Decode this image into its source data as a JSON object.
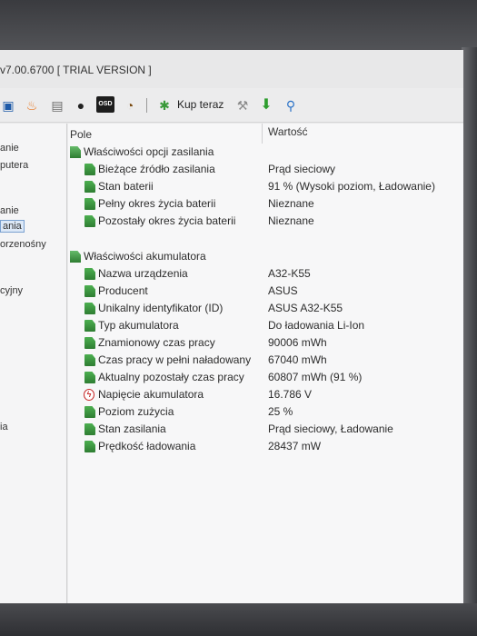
{
  "window": {
    "title": "v7.00.6700  [ TRIAL VERSION ]"
  },
  "toolbar": {
    "icons": [
      "computer-icon",
      "flame-icon",
      "report-icon",
      "user-icon",
      "osd-icon",
      "gauge-icon",
      "cart-icon",
      "tools-icon",
      "download-icon",
      "search-icon"
    ],
    "osd_label": "OSD",
    "buy_label": "Kup teraz"
  },
  "sidebar": {
    "items": [
      {
        "label": "anie"
      },
      {
        "label": "putera"
      },
      {
        "label": "anie"
      },
      {
        "label": "ania"
      },
      {
        "label": "orzenośny"
      },
      {
        "label": "cyjny"
      },
      {
        "label": "ia"
      }
    ]
  },
  "table": {
    "col_field": "Pole",
    "col_value": "Wartość",
    "sections": [
      {
        "title": "Właściwości opcji zasilania",
        "rows": [
          {
            "field": "Bieżące źródło zasilania",
            "value": "Prąd sieciowy"
          },
          {
            "field": "Stan baterii",
            "value": "91 % (Wysoki poziom, Ładowanie)"
          },
          {
            "field": "Pełny okres życia baterii",
            "value": "Nieznane"
          },
          {
            "field": "Pozostały okres życia baterii",
            "value": "Nieznane"
          }
        ]
      },
      {
        "title": "Właściwości akumulatora",
        "rows": [
          {
            "field": "Nazwa urządzenia",
            "value": "A32-K55"
          },
          {
            "field": "Producent",
            "value": "ASUS"
          },
          {
            "field": "Unikalny identyfikator (ID)",
            "value": "ASUS A32-K55"
          },
          {
            "field": "Typ akumulatora",
            "value": "Do ładowania Li-Ion"
          },
          {
            "field": "Znamionowy czas pracy",
            "value": "90006 mWh"
          },
          {
            "field": "Czas pracy w pełni naładowany",
            "value": "67040 mWh"
          },
          {
            "field": "Aktualny pozostały czas pracy",
            "value": "60807 mWh  (91 %)"
          },
          {
            "field": "Napięcie akumulatora",
            "value": "16.786 V"
          },
          {
            "field": "Poziom zużycia",
            "value": "25 %"
          },
          {
            "field": "Stan zasilania",
            "value": "Prąd sieciowy, Ładowanie"
          },
          {
            "field": "Prędkość ładowania",
            "value": "28437 mW"
          }
        ]
      }
    ]
  },
  "colors": {
    "icon_green": "#2e7d32",
    "warning_red": "#c62828",
    "selection_blue": "#dce8f7"
  }
}
